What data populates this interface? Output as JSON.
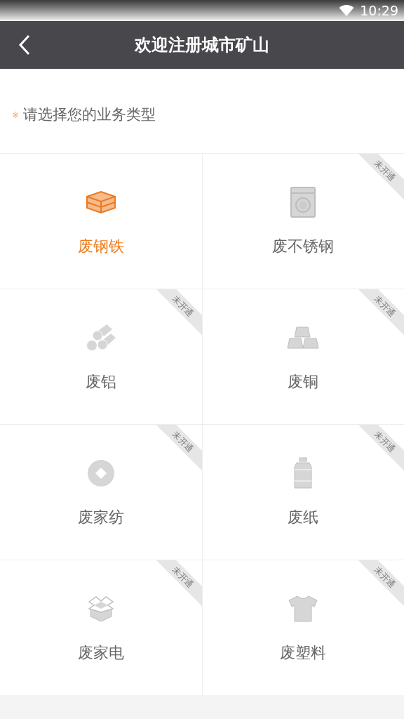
{
  "status_bar": {
    "time": "10:29"
  },
  "header": {
    "title": "欢迎注册城市矿山"
  },
  "prompt": {
    "mark": "※",
    "text": "请选择您的业务类型"
  },
  "items": [
    {
      "label": "废钢铁",
      "selected": true
    },
    {
      "label": "废不锈钢",
      "selected": false,
      "badge": "未开通"
    },
    {
      "label": "废铝",
      "selected": false,
      "badge": "未开通"
    },
    {
      "label": "废铜",
      "selected": false,
      "badge": "未开通"
    },
    {
      "label": "废家纺",
      "selected": false,
      "badge": "未开通"
    },
    {
      "label": "废纸",
      "selected": false,
      "badge": "未开通"
    },
    {
      "label": "废家电",
      "selected": false,
      "badge": "未开通"
    },
    {
      "label": "废塑料",
      "selected": false,
      "badge": "未开通"
    }
  ]
}
